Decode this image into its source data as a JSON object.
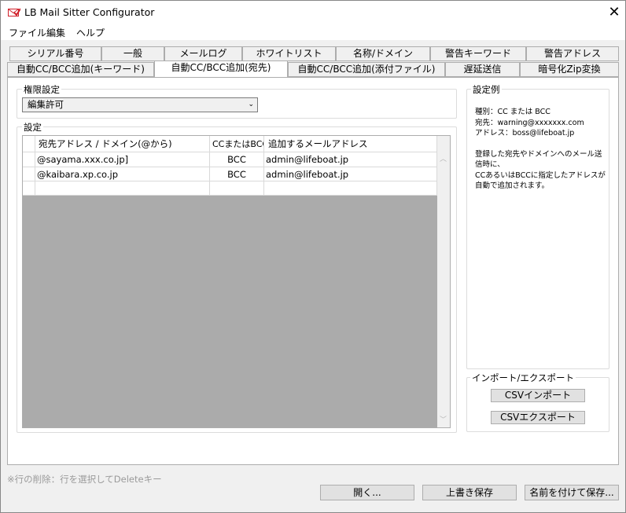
{
  "window": {
    "title": "LB Mail Sitter Configurator",
    "close_glyph": "✕"
  },
  "menu": [
    "ファイル",
    "編集",
    "ヘルプ"
  ],
  "tabs_row1": [
    "シリアル番号",
    "一般",
    "メールログ",
    "ホワイトリスト",
    "名称/ドメイン",
    "警告キーワード",
    "警告アドレス"
  ],
  "tabs_row2": [
    "自動CC/BCC追加(キーワード)",
    "自動CC/BCC追加(宛先)",
    "自動CC/BCC追加(添付ファイル)",
    "遅延送信",
    "暗号化Zip変換"
  ],
  "active_tab": "自動CC/BCC追加(宛先)",
  "permission": {
    "label": "権限設定",
    "selected": "編集許可"
  },
  "settings": {
    "label": "設定",
    "columns": [
      "宛先アドレス / ドメイン(@から)",
      "CCまたはBCC",
      "追加するメールアドレス"
    ],
    "rows": [
      [
        "@sayama.xxx.co.jp]",
        "BCC",
        "admin@lifeboat.jp"
      ],
      [
        "@kaibara.xp.co.jp",
        "BCC",
        "admin@lifeboat.jp"
      ],
      [
        "",
        "",
        ""
      ]
    ]
  },
  "example": {
    "label": "設定例",
    "lines": [
      "種別：CC または BCC",
      "宛先：warning@xxxxxxx.com",
      "アドレス：boss@lifeboat.jp",
      "",
      "登録した宛先やドメインへのメール送信時に、",
      "CCあるいはBCCに指定したアドレスが自動で追加されます。"
    ]
  },
  "import_export": {
    "label": "インポート/エクスポート",
    "import": "CSVインポート",
    "export": "CSVエクスポート"
  },
  "footer": {
    "hint": "※行の削除：行を選択してDeleteキー",
    "open": "開く...",
    "save": "上書き保存",
    "save_as": "名前を付けて保存..."
  },
  "colors": {
    "accent_icon": "#d0202a",
    "panel_bg": "#ffffff",
    "window_bg": "#f0f0f0",
    "grid_bg": "#ababab"
  }
}
